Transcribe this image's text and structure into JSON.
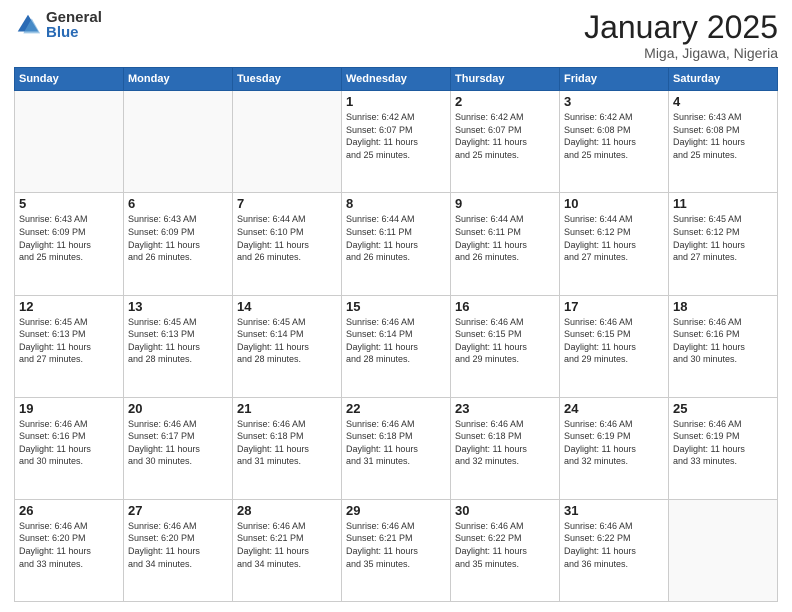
{
  "header": {
    "logo_general": "General",
    "logo_blue": "Blue",
    "title": "January 2025",
    "location": "Miga, Jigawa, Nigeria"
  },
  "weekdays": [
    "Sunday",
    "Monday",
    "Tuesday",
    "Wednesday",
    "Thursday",
    "Friday",
    "Saturday"
  ],
  "weeks": [
    [
      {
        "day": "",
        "info": ""
      },
      {
        "day": "",
        "info": ""
      },
      {
        "day": "",
        "info": ""
      },
      {
        "day": "1",
        "info": "Sunrise: 6:42 AM\nSunset: 6:07 PM\nDaylight: 11 hours\nand 25 minutes."
      },
      {
        "day": "2",
        "info": "Sunrise: 6:42 AM\nSunset: 6:07 PM\nDaylight: 11 hours\nand 25 minutes."
      },
      {
        "day": "3",
        "info": "Sunrise: 6:42 AM\nSunset: 6:08 PM\nDaylight: 11 hours\nand 25 minutes."
      },
      {
        "day": "4",
        "info": "Sunrise: 6:43 AM\nSunset: 6:08 PM\nDaylight: 11 hours\nand 25 minutes."
      }
    ],
    [
      {
        "day": "5",
        "info": "Sunrise: 6:43 AM\nSunset: 6:09 PM\nDaylight: 11 hours\nand 25 minutes."
      },
      {
        "day": "6",
        "info": "Sunrise: 6:43 AM\nSunset: 6:09 PM\nDaylight: 11 hours\nand 26 minutes."
      },
      {
        "day": "7",
        "info": "Sunrise: 6:44 AM\nSunset: 6:10 PM\nDaylight: 11 hours\nand 26 minutes."
      },
      {
        "day": "8",
        "info": "Sunrise: 6:44 AM\nSunset: 6:11 PM\nDaylight: 11 hours\nand 26 minutes."
      },
      {
        "day": "9",
        "info": "Sunrise: 6:44 AM\nSunset: 6:11 PM\nDaylight: 11 hours\nand 26 minutes."
      },
      {
        "day": "10",
        "info": "Sunrise: 6:44 AM\nSunset: 6:12 PM\nDaylight: 11 hours\nand 27 minutes."
      },
      {
        "day": "11",
        "info": "Sunrise: 6:45 AM\nSunset: 6:12 PM\nDaylight: 11 hours\nand 27 minutes."
      }
    ],
    [
      {
        "day": "12",
        "info": "Sunrise: 6:45 AM\nSunset: 6:13 PM\nDaylight: 11 hours\nand 27 minutes."
      },
      {
        "day": "13",
        "info": "Sunrise: 6:45 AM\nSunset: 6:13 PM\nDaylight: 11 hours\nand 28 minutes."
      },
      {
        "day": "14",
        "info": "Sunrise: 6:45 AM\nSunset: 6:14 PM\nDaylight: 11 hours\nand 28 minutes."
      },
      {
        "day": "15",
        "info": "Sunrise: 6:46 AM\nSunset: 6:14 PM\nDaylight: 11 hours\nand 28 minutes."
      },
      {
        "day": "16",
        "info": "Sunrise: 6:46 AM\nSunset: 6:15 PM\nDaylight: 11 hours\nand 29 minutes."
      },
      {
        "day": "17",
        "info": "Sunrise: 6:46 AM\nSunset: 6:15 PM\nDaylight: 11 hours\nand 29 minutes."
      },
      {
        "day": "18",
        "info": "Sunrise: 6:46 AM\nSunset: 6:16 PM\nDaylight: 11 hours\nand 30 minutes."
      }
    ],
    [
      {
        "day": "19",
        "info": "Sunrise: 6:46 AM\nSunset: 6:16 PM\nDaylight: 11 hours\nand 30 minutes."
      },
      {
        "day": "20",
        "info": "Sunrise: 6:46 AM\nSunset: 6:17 PM\nDaylight: 11 hours\nand 30 minutes."
      },
      {
        "day": "21",
        "info": "Sunrise: 6:46 AM\nSunset: 6:18 PM\nDaylight: 11 hours\nand 31 minutes."
      },
      {
        "day": "22",
        "info": "Sunrise: 6:46 AM\nSunset: 6:18 PM\nDaylight: 11 hours\nand 31 minutes."
      },
      {
        "day": "23",
        "info": "Sunrise: 6:46 AM\nSunset: 6:18 PM\nDaylight: 11 hours\nand 32 minutes."
      },
      {
        "day": "24",
        "info": "Sunrise: 6:46 AM\nSunset: 6:19 PM\nDaylight: 11 hours\nand 32 minutes."
      },
      {
        "day": "25",
        "info": "Sunrise: 6:46 AM\nSunset: 6:19 PM\nDaylight: 11 hours\nand 33 minutes."
      }
    ],
    [
      {
        "day": "26",
        "info": "Sunrise: 6:46 AM\nSunset: 6:20 PM\nDaylight: 11 hours\nand 33 minutes."
      },
      {
        "day": "27",
        "info": "Sunrise: 6:46 AM\nSunset: 6:20 PM\nDaylight: 11 hours\nand 34 minutes."
      },
      {
        "day": "28",
        "info": "Sunrise: 6:46 AM\nSunset: 6:21 PM\nDaylight: 11 hours\nand 34 minutes."
      },
      {
        "day": "29",
        "info": "Sunrise: 6:46 AM\nSunset: 6:21 PM\nDaylight: 11 hours\nand 35 minutes."
      },
      {
        "day": "30",
        "info": "Sunrise: 6:46 AM\nSunset: 6:22 PM\nDaylight: 11 hours\nand 35 minutes."
      },
      {
        "day": "31",
        "info": "Sunrise: 6:46 AM\nSunset: 6:22 PM\nDaylight: 11 hours\nand 36 minutes."
      },
      {
        "day": "",
        "info": ""
      }
    ]
  ]
}
